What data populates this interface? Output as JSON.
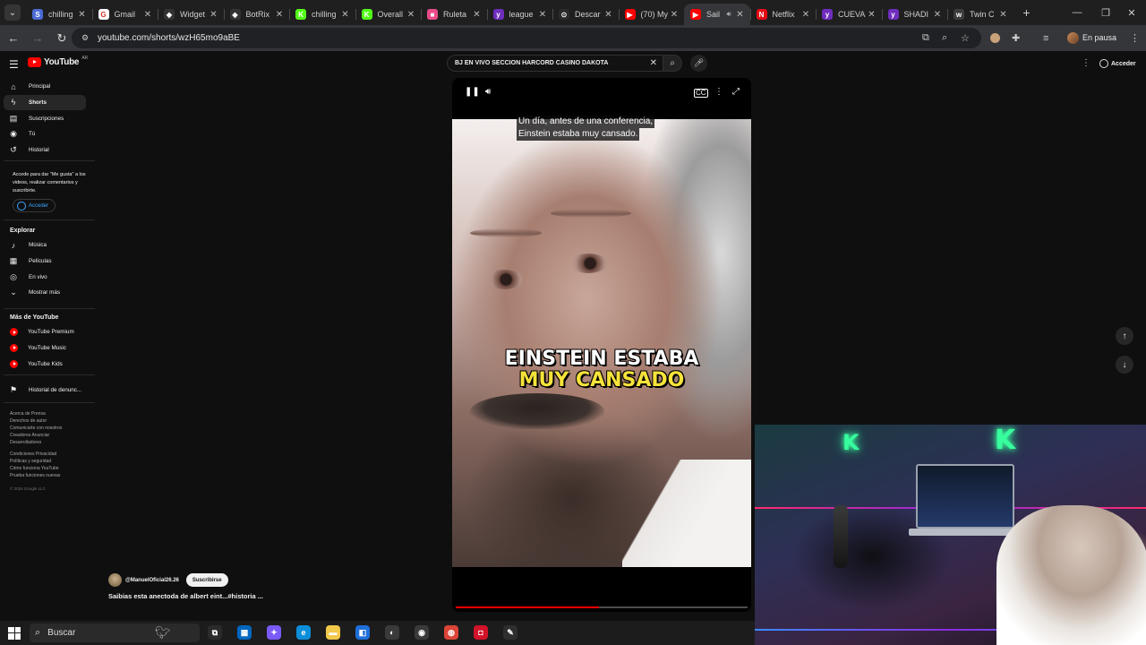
{
  "browser": {
    "tabs": [
      {
        "title": "chilling",
        "favicon_color": "#4b6bd6",
        "favicon_glyph": "S"
      },
      {
        "title": "Gmail",
        "favicon_color": "#ffffff",
        "favicon_glyph": "G"
      },
      {
        "title": "Widget",
        "favicon_color": "#333333",
        "favicon_glyph": "◆"
      },
      {
        "title": "BotRix",
        "favicon_color": "#333333",
        "favicon_glyph": "◆"
      },
      {
        "title": "chilling",
        "favicon_color": "#53fc18",
        "favicon_glyph": "K"
      },
      {
        "title": "Overall",
        "favicon_color": "#53fc18",
        "favicon_glyph": "K"
      },
      {
        "title": "Ruleta",
        "favicon_color": "#e94b8a",
        "favicon_glyph": "■"
      },
      {
        "title": "league",
        "favicon_color": "#6f2dbd",
        "favicon_glyph": "y"
      },
      {
        "title": "Descar",
        "favicon_color": "#2a2a2a",
        "favicon_glyph": "⊙"
      },
      {
        "title": "(70) My",
        "favicon_color": "#ff0000",
        "favicon_glyph": "▶"
      },
      {
        "title": "Sail",
        "favicon_color": "#ff0000",
        "favicon_glyph": "▶",
        "active": true,
        "audio": true
      },
      {
        "title": "Netflix",
        "favicon_color": "#e50914",
        "favicon_glyph": "N"
      },
      {
        "title": "CUEVA",
        "favicon_color": "#6f2dbd",
        "favicon_glyph": "y"
      },
      {
        "title": "SHADI",
        "favicon_color": "#6f2dbd",
        "favicon_glyph": "y"
      },
      {
        "title": "Twin C",
        "favicon_color": "#3d3d3d",
        "favicon_glyph": "w"
      }
    ],
    "url": "youtube.com/shorts/wzH65mo9aBE",
    "profile_status": "En pausa"
  },
  "youtube": {
    "logo_text": "YouTube",
    "region": "AR",
    "search_query": "BJ EN VIVO SECCION HARCORD CASINO DAKOTA",
    "signin_label": "Acceder"
  },
  "sidebar": {
    "main": [
      {
        "label": "Principal",
        "icon": "home-icon",
        "glyph": "⌂"
      },
      {
        "label": "Shorts",
        "icon": "shorts-icon",
        "glyph": "ϟ",
        "active": true
      },
      {
        "label": "Suscripciones",
        "icon": "subscriptions-icon",
        "glyph": "▤"
      },
      {
        "label": "Tú",
        "icon": "you-icon",
        "glyph": "◉"
      },
      {
        "label": "Historial",
        "icon": "history-icon",
        "glyph": "↺"
      }
    ],
    "signin_prompt": "Accede para dar \"Me gusta\" a los videos, realizar comentarios y suscribirte.",
    "signin_button": "Acceder",
    "explore_heading": "Explorar",
    "explore": [
      {
        "label": "Música",
        "icon": "music-icon",
        "glyph": "♪"
      },
      {
        "label": "Películas",
        "icon": "movies-icon",
        "glyph": "▦"
      },
      {
        "label": "En vivo",
        "icon": "live-icon",
        "glyph": "◎"
      },
      {
        "label": "Mostrar más",
        "icon": "chevron-down-icon",
        "glyph": "⌄"
      }
    ],
    "more_heading": "Más de YouTube",
    "more": [
      {
        "label": "YouTube Premium"
      },
      {
        "label": "YouTube Music"
      },
      {
        "label": "YouTube Kids"
      }
    ],
    "report_history": "Historial de denunc...",
    "footer_1": "Acerca de  Prensa\nDerechos de autor\nComunicarte con nosotros\nCreadores  Anunciar\nDesarrolladores",
    "footer_2": "Condiciones  Privacidad\nPolíticas y seguridad\nCómo funciona YouTube\nPrueba funciones nuevas",
    "copyright": "© 2024 Google LLC"
  },
  "short": {
    "caption_line_1": "Un día, antes de una conferencia,",
    "caption_line_2": "Einstein estaba muy cansado.",
    "overlay_line_1": "EINSTEIN ESTABA",
    "overlay_line_2": "MUY CANSADO",
    "progress": 0.49,
    "channel": "@ManuelOficial26.26",
    "subscribe_label": "Suscribirse",
    "title": "Saibias esta anectoda de albert eint...#historia ..."
  },
  "webcam": {
    "neon_letter": "K"
  },
  "taskbar": {
    "search_label": "Buscar",
    "apps": [
      {
        "name": "task-view-icon",
        "color": "#2b2b2b",
        "glyph": "⧉"
      },
      {
        "name": "widgets-icon",
        "color": "#0067c0",
        "glyph": "▦"
      },
      {
        "name": "copilot-icon",
        "color": "#7a5af8",
        "glyph": "✦"
      },
      {
        "name": "edge-icon",
        "color": "#0c8ed9",
        "glyph": "e"
      },
      {
        "name": "file-explorer-icon",
        "color": "#f2c84b",
        "glyph": "▬"
      },
      {
        "name": "store-icon",
        "color": "#1e6fd9",
        "glyph": "◧"
      },
      {
        "name": "obs-icon",
        "color": "#3a3a3a",
        "glyph": "◐"
      },
      {
        "name": "recorder-icon",
        "color": "#3a3a3a",
        "glyph": "◉"
      },
      {
        "name": "chrome-icon",
        "color": "#db4437",
        "glyph": "◍"
      },
      {
        "name": "app-red-icon",
        "color": "#d1132a",
        "glyph": "◘"
      },
      {
        "name": "app-gold-icon",
        "color": "#2e2e2e",
        "glyph": "✎"
      }
    ]
  }
}
